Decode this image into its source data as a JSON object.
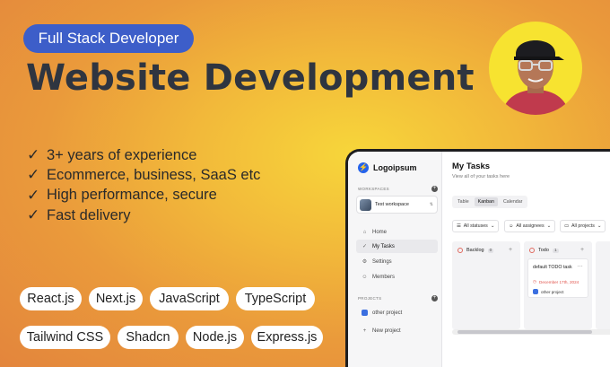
{
  "badge": "Full Stack Developer",
  "headline": "Website Development",
  "features": [
    "3+ years of experience",
    "Ecommerce, business, SaaS etc",
    "High performance, secure",
    "Fast delivery"
  ],
  "tags": [
    "React.js",
    "Next.js",
    "JavaScript",
    "TypeScript",
    "Tailwind CSS",
    "Shadcn",
    "Node.js",
    "Express.js"
  ],
  "colors": {
    "badge_bg": "#3d5ec9",
    "headline": "#2f3540",
    "accent": "#2563eb"
  },
  "app": {
    "logo": "Logoipsum",
    "workspaces_label": "WORKSPACES",
    "workspace_name": "Test workspace",
    "nav": [
      "Home",
      "My Tasks",
      "Settings",
      "Members"
    ],
    "projects_label": "PROJECTS",
    "projects": [
      "other project"
    ],
    "new_project": "New project",
    "title": "My Tasks",
    "subtitle": "View all of your tasks here",
    "tabs": [
      "Table",
      "Kanban",
      "Calendar"
    ],
    "active_tab": "Kanban",
    "filters": [
      "All statuses",
      "All assignees",
      "All projects"
    ],
    "columns": [
      {
        "name": "Backlog",
        "count": "0"
      },
      {
        "name": "Todo",
        "count": "1"
      }
    ],
    "card": {
      "title": "default TODO task",
      "date": "December 17th, 2024",
      "project": "other project"
    }
  }
}
